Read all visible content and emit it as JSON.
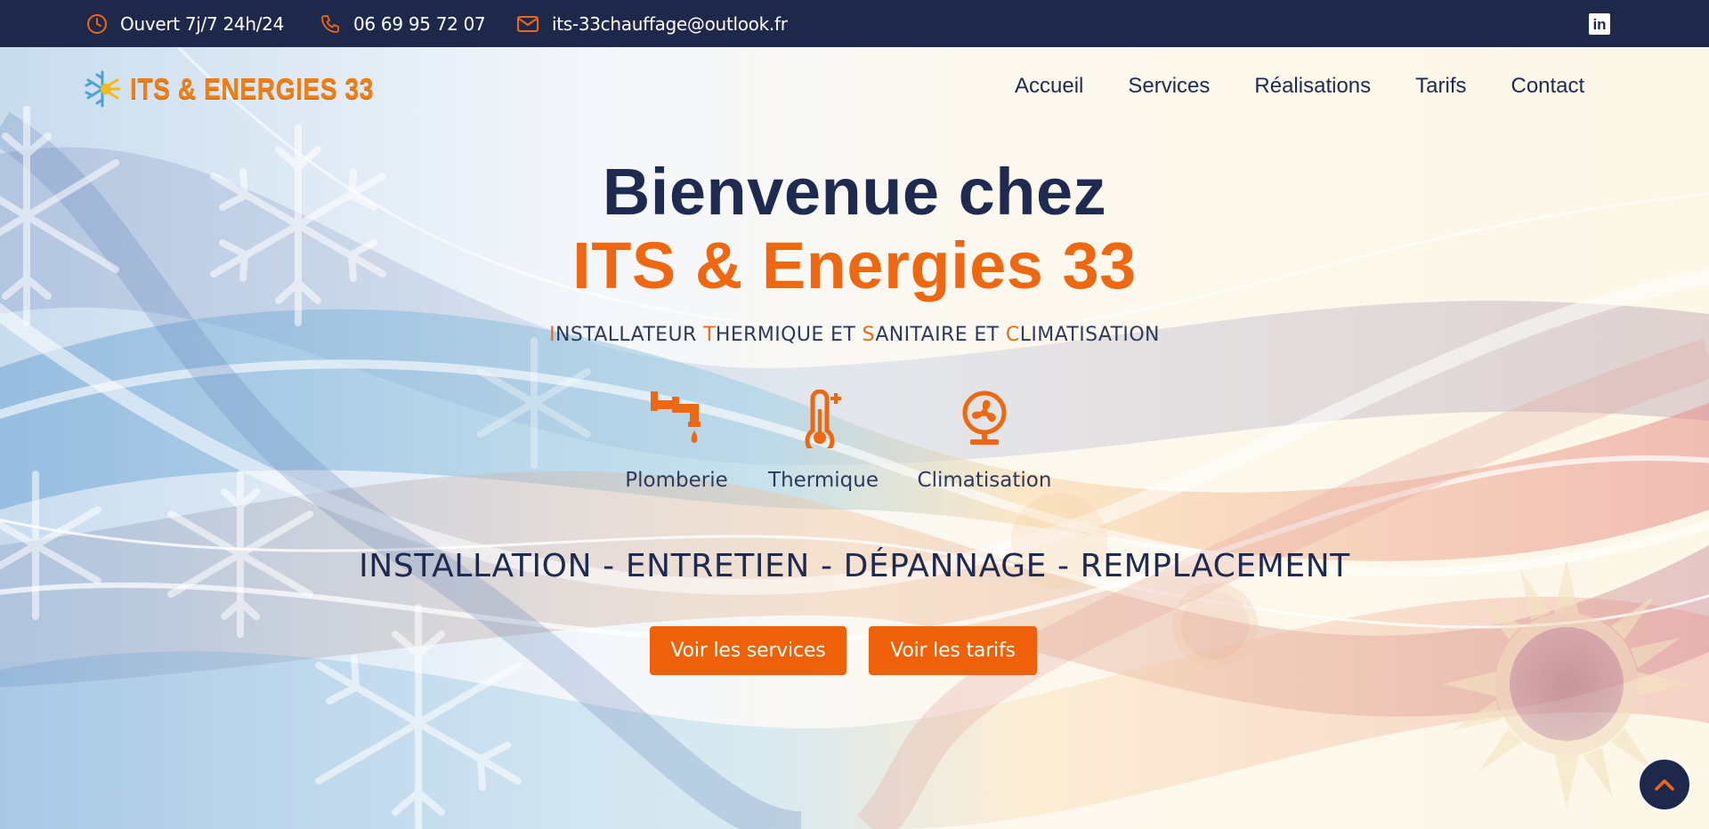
{
  "topbar": {
    "hours": "Ouvert 7j/7 24h/24",
    "phone": "06 69 95 72 07",
    "email": "its-33chauffage@outlook.fr",
    "social_icon": "linkedin-icon",
    "linkedin_glyph": "in"
  },
  "logo": {
    "text": "ITS & ENERGIES 33",
    "icon": "snowflake-sun-icon"
  },
  "nav": {
    "items": [
      {
        "label": "Accueil"
      },
      {
        "label": "Services"
      },
      {
        "label": "Réalisations"
      },
      {
        "label": "Tarifs"
      },
      {
        "label": "Contact"
      }
    ]
  },
  "hero": {
    "title_line1": "Bienvenue chez",
    "title_line2": "ITS & Energies 33",
    "subtitle": {
      "w1_initial": "I",
      "w1_rest": "NSTALLATEUR ",
      "w2_initial": "T",
      "w2_rest": "HERMIQUE ET ",
      "w3_initial": "S",
      "w3_rest": "ANITAIRE ET ",
      "w4_initial": "C",
      "w4_rest": "LIMATISATION"
    },
    "services": [
      {
        "label": "Plomberie",
        "icon": "faucet-icon"
      },
      {
        "label": "Thermique",
        "icon": "thermometer-icon"
      },
      {
        "label": "Climatisation",
        "icon": "fan-icon"
      }
    ],
    "tagline": "INSTALLATION - ENTRETIEN - DÉPANNAGE - REMPLACEMENT",
    "buttons": {
      "services": "Voir les services",
      "tarifs": "Voir les tarifs"
    }
  },
  "colors": {
    "navy": "#1e284b",
    "orange": "#ee6108",
    "text": "#1e2a4f"
  }
}
